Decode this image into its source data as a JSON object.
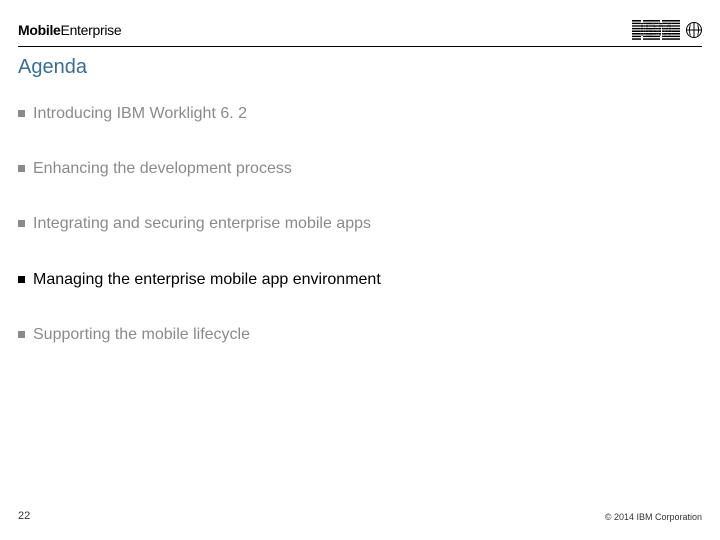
{
  "header": {
    "brand_bold": "Mobile",
    "brand_light": "Enterprise",
    "logo_name": "ibm-logo",
    "globe_name": "globe-icon"
  },
  "title": "Agenda",
  "agenda": {
    "items": [
      {
        "text": "Introducing IBM Worklight 6. 2",
        "active": false
      },
      {
        "text": "Enhancing the development process",
        "active": false
      },
      {
        "text": "Integrating and securing enterprise mobile apps",
        "active": false
      },
      {
        "text": "Managing the enterprise mobile app environment",
        "active": true
      },
      {
        "text": "Supporting the mobile lifecycle",
        "active": false
      }
    ]
  },
  "footer": {
    "page_number": "22",
    "copyright": "© 2014 IBM Corporation"
  }
}
